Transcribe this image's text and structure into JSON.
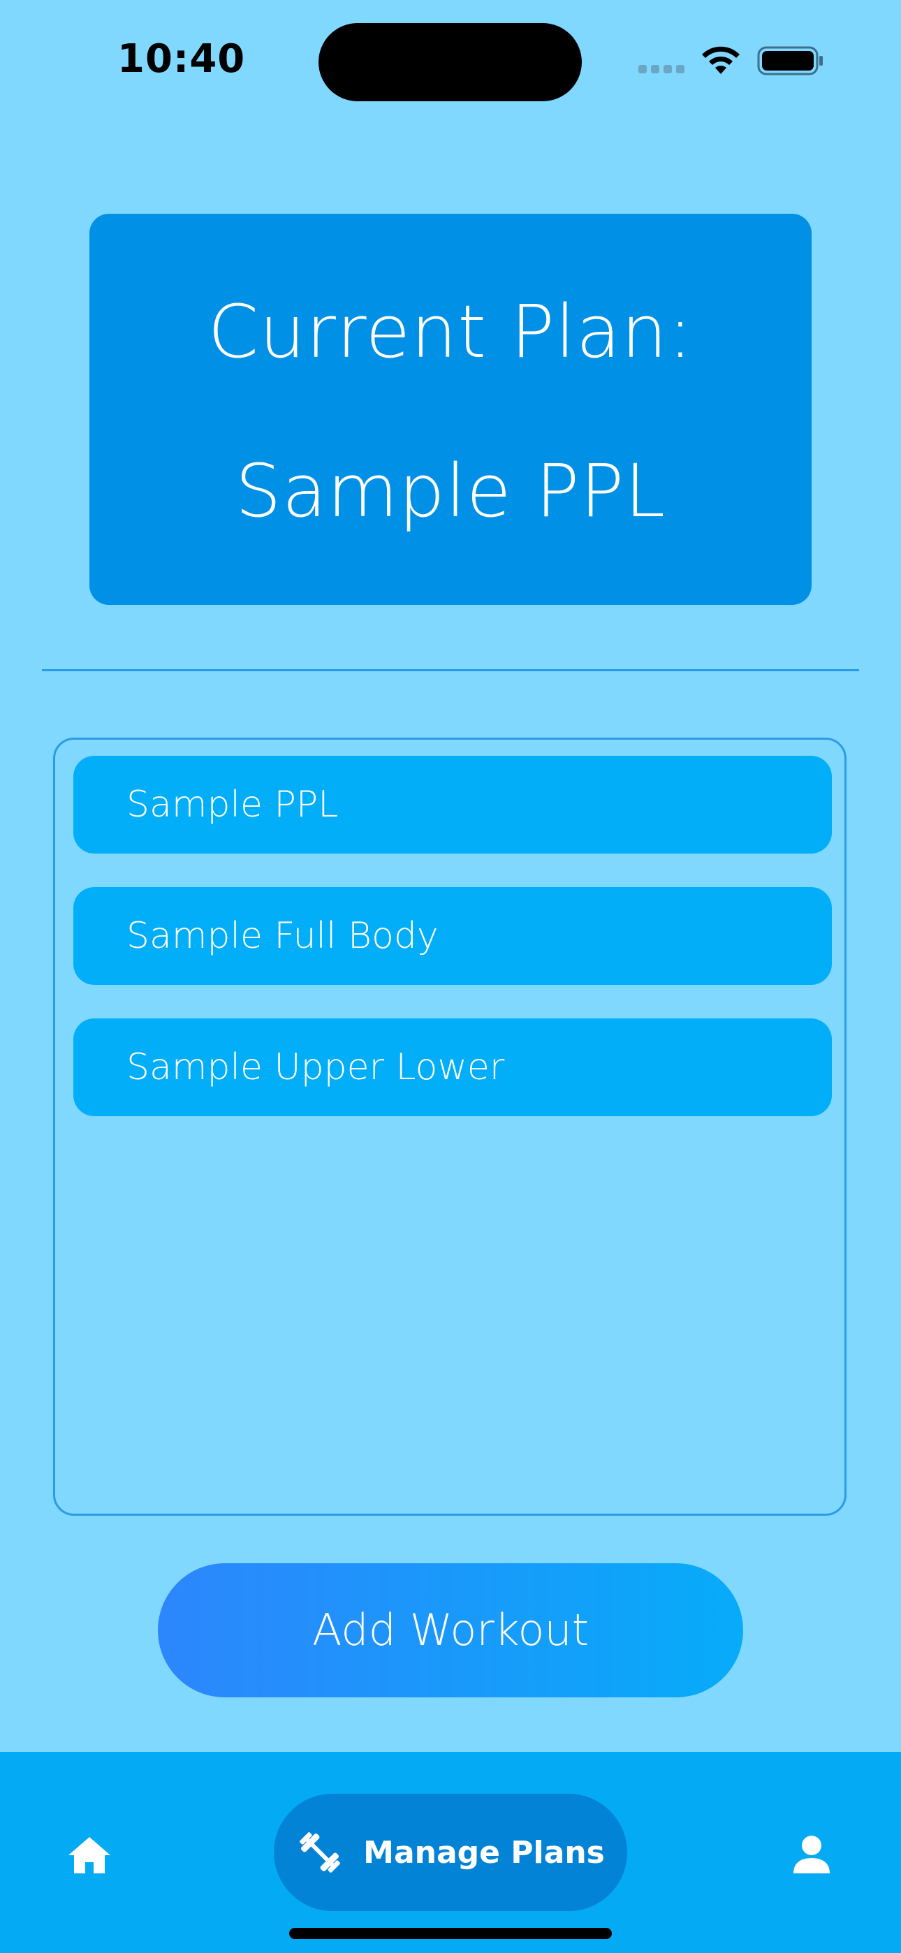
{
  "status_bar": {
    "time": "10:40"
  },
  "current_plan": {
    "heading": "Current Plan:",
    "name": "Sample PPL"
  },
  "plans": [
    {
      "label": "Sample PPL"
    },
    {
      "label": "Sample Full Body"
    },
    {
      "label": "Sample Upper Lower"
    }
  ],
  "add_button": {
    "label": "Add Workout"
  },
  "nav": {
    "home_icon": "house-icon",
    "manage_label": "Manage Plans",
    "manage_icon": "dumbbell-icon",
    "profile_icon": "person-icon"
  },
  "colors": {
    "background": "#81D8FF",
    "card": "#0090E6",
    "list_item": "#03AEF8",
    "nav_bar": "#04AAF4",
    "nav_pill": "#0283D6",
    "button_gradient_start": "#2D86FC",
    "button_gradient_end": "#07ABF9"
  }
}
